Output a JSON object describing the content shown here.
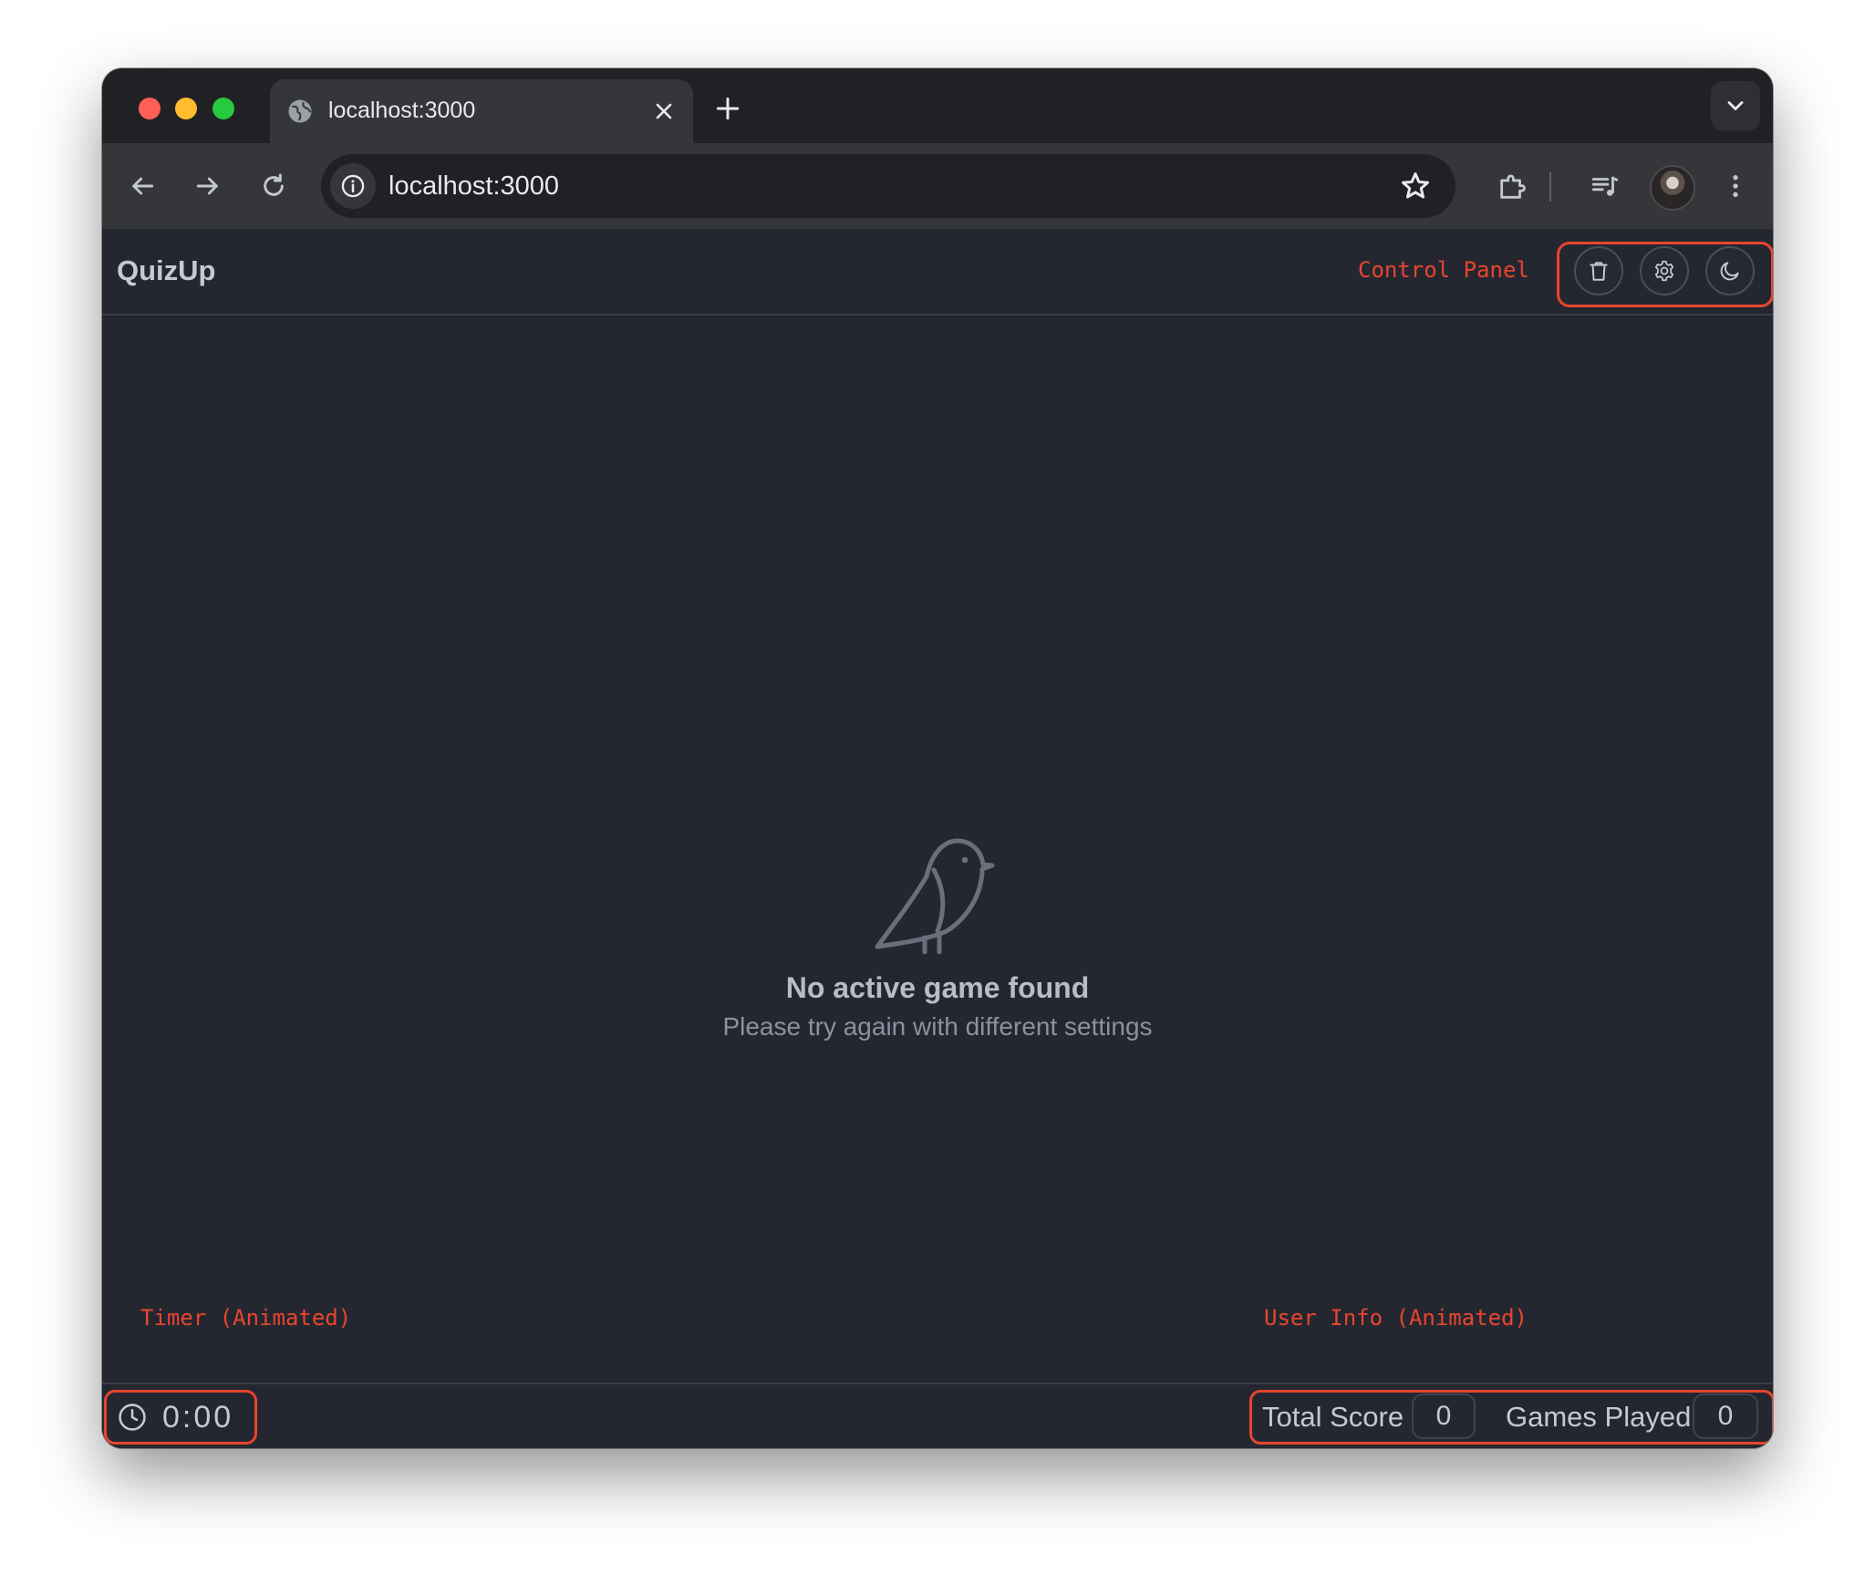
{
  "browser": {
    "tab_title": "localhost:3000",
    "url": "localhost:3000"
  },
  "app": {
    "brand": "QuizUp",
    "control_panel_annotation": "Control Panel",
    "actions": [
      "trash-icon",
      "gear-icon",
      "moon-icon"
    ]
  },
  "empty_state": {
    "icon": "bird-icon",
    "title": "No active game found",
    "subtitle": "Please try again with different settings"
  },
  "annotations": {
    "timer": "Timer (Animated)",
    "user_info": "User Info (Animated)",
    "color": "#e8452f"
  },
  "footer": {
    "timer_value": "0:00",
    "total_score_label": "Total Score",
    "total_score_value": "0",
    "games_played_label": "Games Played",
    "games_played_value": "0"
  },
  "colors": {
    "background": "#242730",
    "highlight": "#e8452f"
  }
}
